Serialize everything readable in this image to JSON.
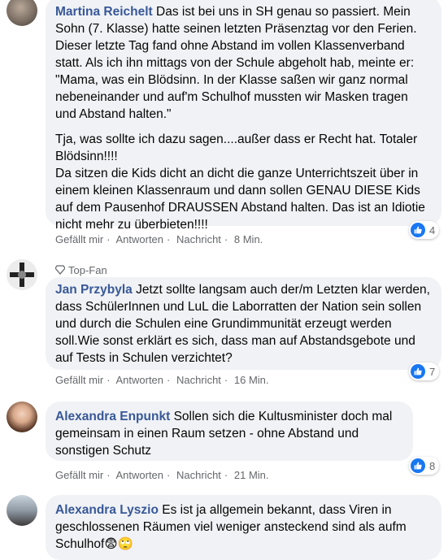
{
  "colors": {
    "bubble_bg": "#f0f2f5",
    "name": "#385898",
    "meta": "#65676b",
    "like_blue": "#1877f2"
  },
  "comments": [
    {
      "author": "Martina Reichelt",
      "text_paragraphs": [
        "Das ist bei uns in SH genau so passiert. Mein Sohn (7. Klasse) hatte seinen letzten Präsenztag vor den Ferien. Dieser letzte Tag fand ohne Abstand im vollen Klassenverband statt. Als ich ihn mittags von der Schule abgeholt hab, meinte er: \"Mama, was ein Blödsinn. In der Klasse saßen wir ganz normal nebeneinander und auf'm Schulhof mussten wir Masken tragen und Abstand halten.\"",
        "Tja, was sollte ich dazu sagen....außer dass er Recht hat. Totaler Blödsinn!!!!\nDa sitzen die Kids dicht an dicht die ganze Unterrichtszeit über in einem kleinen Klassenraum und dann sollen GENAU DIESE Kids auf dem Pausenhof DRAUSSEN Abstand halten. Das ist an Idiotie nicht mehr zu überbieten!!!!"
      ],
      "reactions": "4",
      "actions": {
        "like": "Gefällt mir",
        "reply": "Antworten",
        "message": "Nachricht",
        "time": "8 Min."
      }
    },
    {
      "badge": "Top-Fan",
      "author": "Jan Przybyla",
      "text": "Jetzt sollte langsam auch der/m Letzten klar werden, dass SchülerInnen und LuL die Laborratten der Nation sein sollen und durch die Schulen eine Grundimmunität erzeugt werden soll.Wie sonst erklärt es sich, dass man auf Abstandsgebote und auf Tests in Schulen verzichtet?",
      "reactions": "7",
      "actions": {
        "like": "Gefällt mir",
        "reply": "Antworten",
        "message": "Nachricht",
        "time": "16 Min."
      }
    },
    {
      "author": "Alexandra Enpunkt",
      "text": "Sollen sich die Kultusminister doch mal gemeinsam in einen Raum setzen - ohne Abstand und sonstigen Schutz",
      "reactions": "8",
      "actions": {
        "like": "Gefällt mir",
        "reply": "Antworten",
        "message": "Nachricht",
        "time": "21 Min."
      }
    },
    {
      "author": "Alexandra Lyszio",
      "text": "Es ist ja allgemein bekannt, dass Viren in geschlossenen Räumen viel weniger ansteckend sind als aufm Schulhof😨🙄"
    }
  ]
}
